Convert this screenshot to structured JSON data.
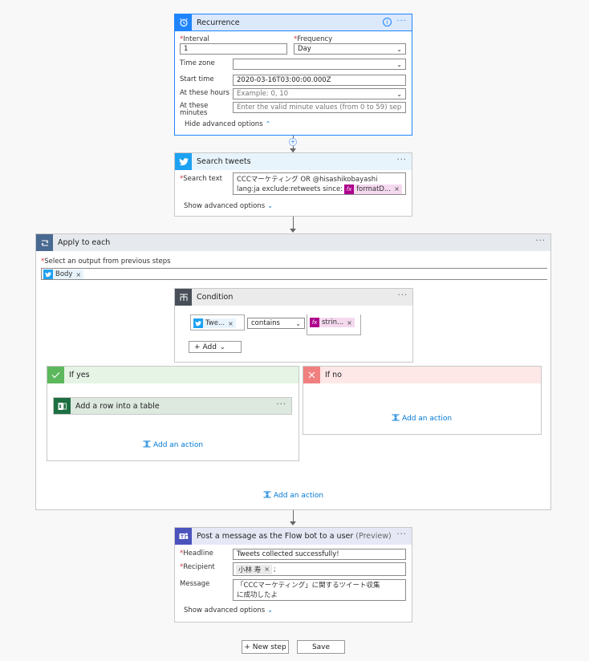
{
  "recurrence": {
    "title": "Recurrence",
    "interval_label": "Interval",
    "interval_value": "1",
    "frequency_label": "Frequency",
    "frequency_value": "Day",
    "timezone_label": "Time zone",
    "timezone_value": "",
    "starttime_label": "Start time",
    "starttime_value": "2020-03-16T03:00:00.000Z",
    "hours_label": "At these hours",
    "hours_placeholder": "Example: 0, 10",
    "minutes_label_1": "At these",
    "minutes_label_2": "minutes",
    "minutes_placeholder": "Enter the valid minute values (from 0 to 59) sep",
    "toggle_label": "Hide advanced options",
    "header_color": "#dbe9fb",
    "icon_color": "#1f85ff"
  },
  "search_tweets": {
    "title": "Search tweets",
    "search_label": "Search text",
    "search_line1": "CCCマーケティング OR @hisashikobayashi",
    "search_line2": "lang:ja exclude:retweets since:",
    "token_label": "formatD...",
    "toggle_label": "Show advanced options",
    "icon_color": "#1da1f2"
  },
  "apply_each": {
    "title": "Apply to each",
    "select_label": "Select an output from previous steps",
    "token_label": "Body",
    "icon_color": "#486991",
    "add_action": "Add an action"
  },
  "condition": {
    "title": "Condition",
    "left_token": "Twe...",
    "operator": "contains",
    "right_token": "strin...",
    "add_label": "Add",
    "icon_color": "#484f58"
  },
  "if_yes": {
    "title": "If yes",
    "action_title": "Add a row into a table",
    "add_action": "Add an action",
    "color": "#5cb85c"
  },
  "if_no": {
    "title": "If no",
    "add_action": "Add an action",
    "color": "#f08080"
  },
  "teams": {
    "title": "Post a message as the Flow bot to a user",
    "title_suffix": "(Preview)",
    "headline_label": "Headline",
    "headline_value": "Tweets collected successfully!",
    "recipient_label": "Recipient",
    "recipient_token": "小林 寿",
    "recipient_suffix": ";",
    "message_label": "Message",
    "message_line1": "「CCCマーケティング」に関するツイート収集",
    "message_line2": "に成功したよ",
    "toggle_label": "Show advanced options",
    "icon_color": "#4b53bc"
  },
  "footer": {
    "new_step": "+ New step",
    "save": "Save"
  }
}
